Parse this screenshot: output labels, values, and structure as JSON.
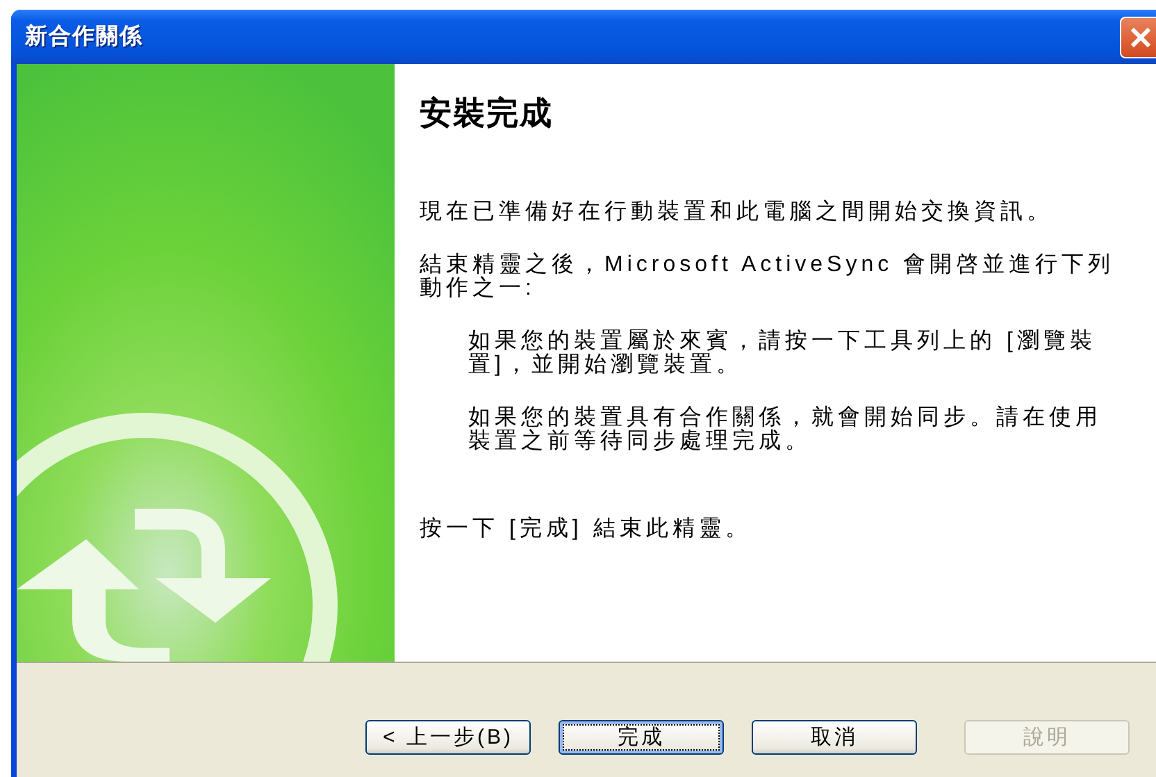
{
  "window": {
    "title": "新合作關係"
  },
  "heading": "安裝完成",
  "paragraphs": [
    {
      "kind": "body",
      "text": "現在已準備好在行動裝置和此電腦之間開始交換資訊。"
    },
    {
      "kind": "body",
      "text": "結束精靈之後，Microsoft ActiveSync 會開啓並進行下列動作之一:"
    },
    {
      "kind": "indented",
      "text": "如果您的裝置屬於來賓，請按一下工具列上的 [瀏覽裝置]，並開始瀏覽裝置。"
    },
    {
      "kind": "indented",
      "text": "如果您的裝置具有合作關係，就會開始同步。請在使用裝置之前等待同步處理完成。"
    },
    {
      "kind": "closing",
      "text": "按一下 [完成] 結束此精靈。"
    }
  ],
  "buttons": [
    {
      "label": "< 上一步(B)",
      "default": false,
      "disabled": false
    },
    {
      "label": "完成",
      "default": true,
      "disabled": false
    },
    {
      "label": "取消",
      "default": false,
      "disabled": false
    },
    {
      "label": "說明",
      "default": false,
      "disabled": true
    }
  ]
}
